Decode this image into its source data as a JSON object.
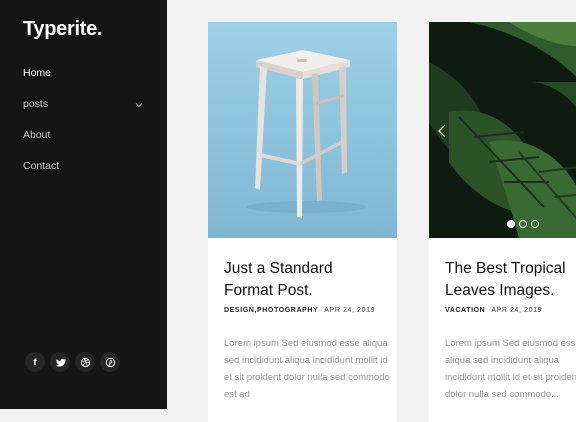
{
  "brand": {
    "logo": "Typerite."
  },
  "nav": {
    "items": [
      {
        "label": "Home"
      },
      {
        "label": "posts"
      },
      {
        "label": "About"
      },
      {
        "label": "Contact"
      }
    ]
  },
  "social": {
    "facebook": "f"
  },
  "posts": [
    {
      "title_line1": "Just a Standard",
      "title_line2": "Format Post.",
      "categories": "DESIGN,PHOTOGRAPHY",
      "date": "APR 24, 2019",
      "excerpt": "Lorem ipsum Sed eiusmod esse aliqua sed incididunt aliqua incididunt mollit id et sit proident dolor nulla sed commodo est ad"
    },
    {
      "title_line1": "The Best Tropical",
      "title_line2": "Leaves Images.",
      "categories": "VACATION",
      "date": "APR 24, 2019",
      "excerpt": "Lorem ipsum Sed eiusmod esse aliqua sed incididunt aliqua incididunt mollit id et sit proident dolor nulla sed commodo..."
    }
  ],
  "colors": {
    "sidebar": "#151515",
    "page": "#f2f2f2"
  }
}
